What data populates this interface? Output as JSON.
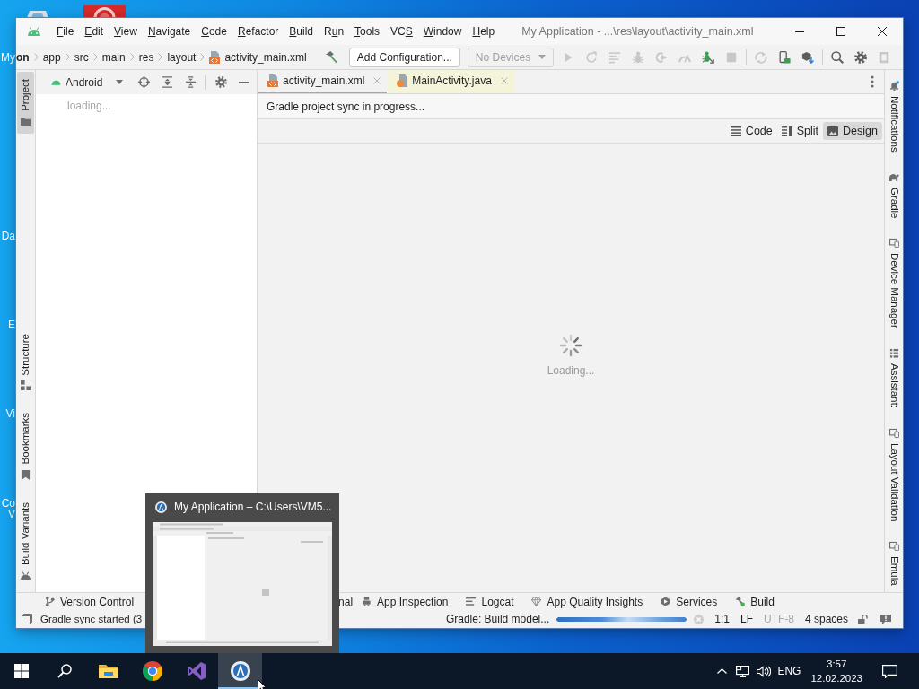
{
  "desktop": {
    "icon_labels": [
      "My",
      "Da",
      "E",
      "Vi",
      "Co",
      "V"
    ]
  },
  "window": {
    "menu": [
      {
        "key": "F",
        "rest": "ile"
      },
      {
        "key": "E",
        "rest": "dit"
      },
      {
        "key": "V",
        "rest": "iew"
      },
      {
        "key": "N",
        "rest": "avigate"
      },
      {
        "key": "C",
        "rest": "ode"
      },
      {
        "key": "R",
        "rest": "efactor"
      },
      {
        "key": "B",
        "rest": "uild"
      },
      {
        "lead": "R",
        "key": "u",
        "rest": "n"
      },
      {
        "key": "T",
        "rest": "ools"
      },
      {
        "lead": "VC",
        "key": "S"
      },
      {
        "key": "W",
        "rest": "indow"
      },
      {
        "key": "H",
        "rest": "elp"
      }
    ],
    "title": "My Application - ...\\res\\layout\\activity_main.xml"
  },
  "navigation_bar": {
    "breadcrumbs": [
      {
        "label": "on",
        "kind": "project"
      },
      {
        "label": "app",
        "kind": "folder"
      },
      {
        "label": "src",
        "kind": "folder"
      },
      {
        "label": "main",
        "kind": "folder"
      },
      {
        "label": "res",
        "kind": "folder"
      },
      {
        "label": "layout",
        "kind": "folder"
      },
      {
        "label": "activity_main.xml",
        "kind": "file"
      }
    ],
    "run_configuration": "Add Configuration...",
    "device_selector": {
      "label": "No Devices",
      "disabled": true
    },
    "toolbar_groups": [
      [
        {
          "kind": "run",
          "disabled": true
        },
        {
          "kind": "rerun",
          "disabled": true
        },
        {
          "kind": "coverage",
          "disabled": true
        },
        {
          "kind": "debug",
          "disabled": true
        },
        {
          "kind": "profile",
          "disabled": true
        },
        {
          "kind": "gauge",
          "disabled": true
        },
        {
          "kind": "attach",
          "disabled": false
        },
        {
          "kind": "stop",
          "disabled": true
        }
      ],
      [
        {
          "kind": "apply",
          "disabled": true
        },
        {
          "kind": "device",
          "disabled": false
        },
        {
          "kind": "sdk",
          "disabled": false
        }
      ],
      [
        {
          "kind": "search",
          "disabled": false
        },
        {
          "kind": "settings",
          "disabled": false
        },
        {
          "kind": "flag",
          "disabled": true
        }
      ]
    ]
  },
  "left_tool_strip": {
    "top": [
      {
        "label": "Project",
        "kind": "folder",
        "selected": true
      }
    ],
    "bottom": [
      {
        "label": "Structure",
        "kind": "structure",
        "selected": false
      },
      {
        "label": "Bookmarks",
        "kind": "bookmark",
        "selected": false
      },
      {
        "label": "Build Variants",
        "kind": "android",
        "selected": false
      }
    ]
  },
  "project_panel": {
    "view": "Android",
    "status": "loading..."
  },
  "editor": {
    "tabs": [
      {
        "label": "activity_main.xml",
        "kind": "xml",
        "selected": true,
        "highlighted": false
      },
      {
        "label": "MainActivity.java",
        "kind": "java",
        "selected": false,
        "highlighted": true
      }
    ],
    "banner": "Gradle project sync in progress...",
    "view_modes": [
      {
        "label": "Code",
        "kind": "code",
        "selected": false
      },
      {
        "label": "Split",
        "kind": "split",
        "selected": false
      },
      {
        "label": "Design",
        "kind": "design",
        "selected": true
      }
    ],
    "canvas_status": "Loading..."
  },
  "right_tool_strip": [
    {
      "label": "Notifications",
      "kind": "bell"
    },
    {
      "label": "Gradle",
      "kind": "elephant"
    },
    {
      "label": "Device Manager",
      "kind": "device"
    },
    {
      "label": "Assistant:",
      "kind": "assistant"
    },
    {
      "label": "Layout Validation",
      "kind": "device"
    },
    {
      "label": "Emula",
      "kind": "device"
    }
  ],
  "bottom_tool_bar": [
    {
      "label": "Version Control",
      "kind": "branch"
    },
    {
      "label": "nal",
      "kind": "text"
    },
    {
      "label": "App Inspection",
      "kind": "inspection"
    },
    {
      "label": "Logcat",
      "kind": "logcat"
    },
    {
      "label": "App Quality Insights",
      "kind": "diamond"
    },
    {
      "label": "Services",
      "kind": "services"
    },
    {
      "label": "Build",
      "kind": "build"
    }
  ],
  "status_bar": {
    "message": "Gradle sync started (3",
    "task": "Gradle: Build model...",
    "progress": {
      "level": 1
    },
    "position": "1:1",
    "line_separator": "LF",
    "encoding": {
      "label": "UTF-8",
      "disabled": true
    },
    "indent": "4 spaces"
  },
  "taskbar_preview": {
    "title": "My Application – C:\\Users\\VM5..."
  },
  "taskbar": {
    "apps": [
      {
        "kind": "explorer",
        "active": false
      },
      {
        "kind": "chrome",
        "active": false
      },
      {
        "kind": "visual-studio",
        "active": false
      },
      {
        "kind": "android-studio",
        "active": true
      }
    ],
    "language": "ENG",
    "time": "3:57",
    "date": "12.02.2023"
  }
}
